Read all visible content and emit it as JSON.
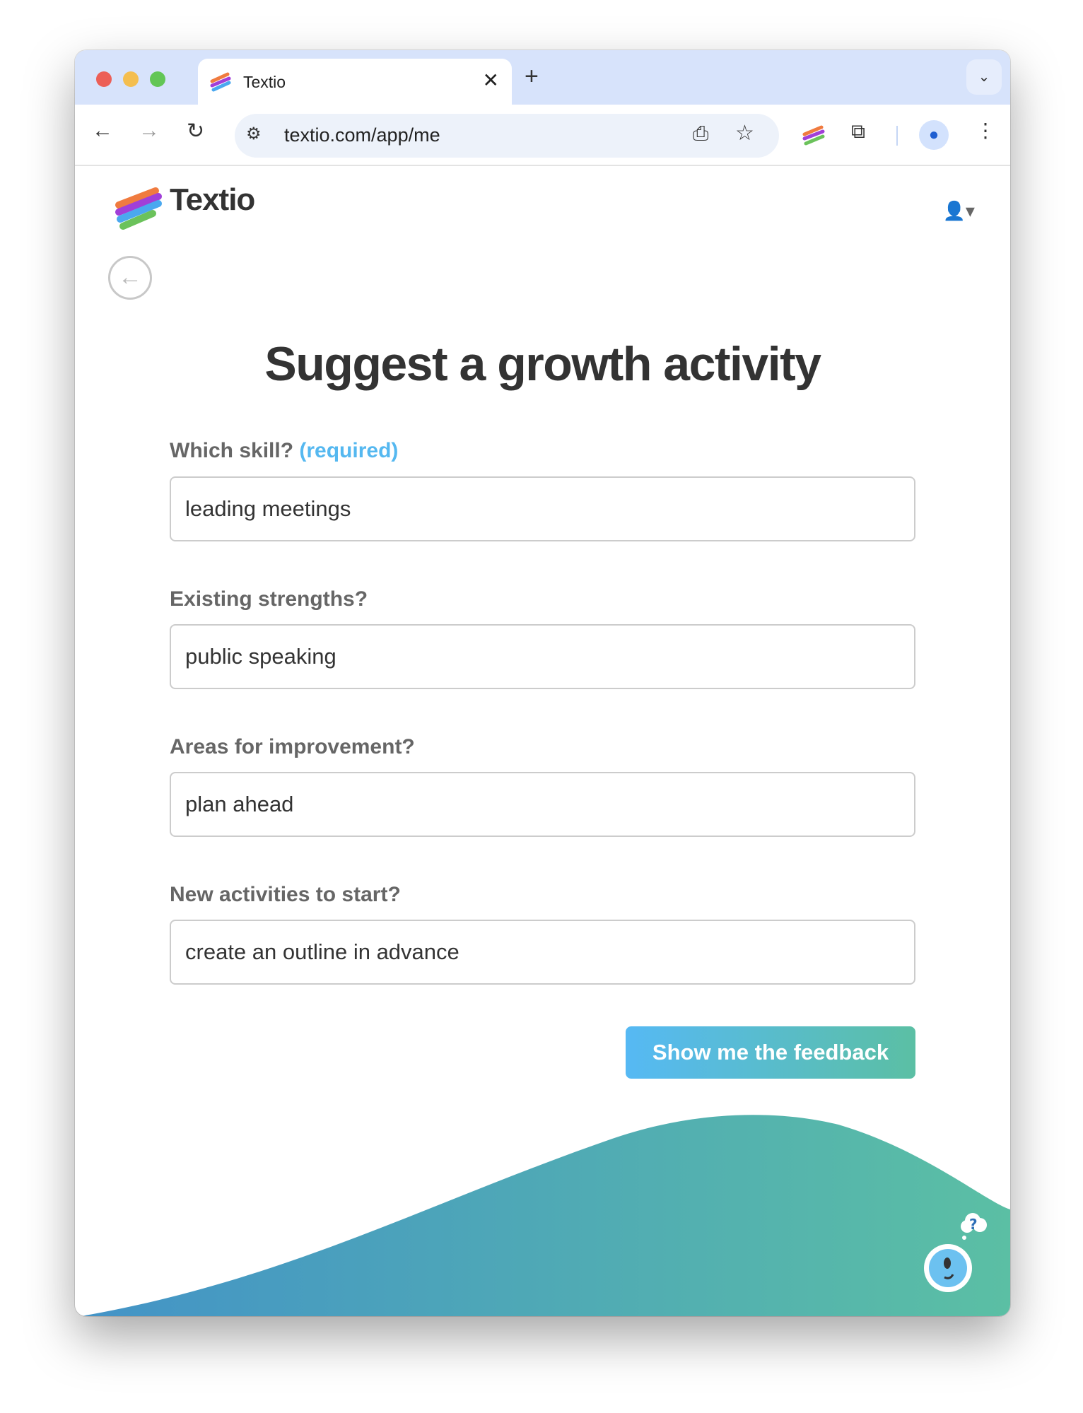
{
  "browser": {
    "tab_title": "Textio",
    "url": "textio.com/app/me",
    "close_glyph": "✕",
    "new_tab_glyph": "+"
  },
  "app": {
    "logo_text": "Textio",
    "title": "Suggest a growth activity",
    "fields": [
      {
        "label": "Which skill?",
        "required": "(required)",
        "value": "leading meetings"
      },
      {
        "label": "Existing strengths?",
        "value": "public speaking"
      },
      {
        "label": "Areas for improvement?",
        "value": "plan ahead"
      },
      {
        "label": "New activities to start?",
        "value": "create an outline in advance"
      }
    ],
    "submit_label": "Show me the feedback",
    "help_glyph": "?"
  },
  "colors": {
    "accent": "#55b8f0",
    "gradient_start": "#4393c7",
    "gradient_end": "#5bbfa4"
  }
}
